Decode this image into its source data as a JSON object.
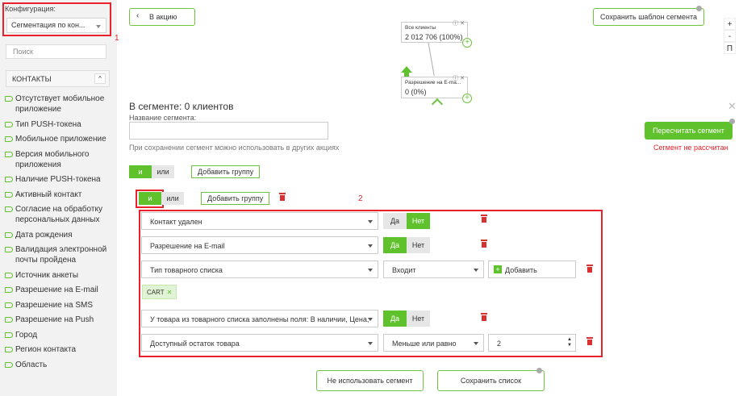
{
  "sidebar": {
    "config_label": "Конфигурация:",
    "config_value": "Сегментация по кон...",
    "annotation_1": "1",
    "search_placeholder": "Поиск",
    "group_label": "КОНТАКТЫ",
    "items": [
      "Отсутствует мобильное приложение",
      "Тип PUSH-токена",
      "Мобильное приложение",
      "Версия мобильного приложения",
      "Наличие PUSH-токена",
      "Активный контакт",
      "Согласие на обработку персональных данных",
      "Дата рождения",
      "Валидация электронной почты пройдена",
      "Источник анкеты",
      "Разрешение на E-mail",
      "Разрешение на SMS",
      "Разрешение на Push",
      "Город",
      "Регион контакта",
      "Область"
    ]
  },
  "top": {
    "back_label": "В акцию",
    "save_template_label": "Сохранить шаблон сегмента",
    "zoom_in": "+",
    "zoom_out": "-",
    "zoom_fit": "П"
  },
  "flow": {
    "node1_title": "Все клиенты",
    "node1_value": "2 012 706 (100%)",
    "node2_title": "Разрешение на E-ma...",
    "node2_value": "0 (0%)"
  },
  "segment": {
    "title": "В сегменте: 0 клиентов",
    "name_label": "Название сегмента:",
    "hint": "При сохранении сегмент можно использовать в других акциях",
    "recalc_label": "Пересчитать сегмент",
    "not_calculated": "Сегмент не рассчитан",
    "and_label": "и",
    "or_label": "или",
    "add_group_label": "Добавить группу",
    "annotation_2": "2"
  },
  "conditions": {
    "c1_field": "Контакт удален",
    "c2_field": "Разрешение на E-mail",
    "c3_field": "Тип товарного списка",
    "c3_operator": "Входит",
    "c3_add": "Добавить",
    "chip": "CART",
    "c4_field": "У товара из товарного списка заполнены поля: В наличии, Цена,",
    "c5_field": "Доступный остаток товара",
    "c5_operator": "Меньше или равно",
    "c5_value": "2",
    "yes": "Да",
    "no": "Нет"
  },
  "bottom": {
    "dont_use_label": "Не использовать сегмент",
    "save_list_label": "Сохранить список"
  },
  "colors": {
    "accent": "#5fc22d",
    "annotation": "#e8212a",
    "delete": "#d93030"
  }
}
